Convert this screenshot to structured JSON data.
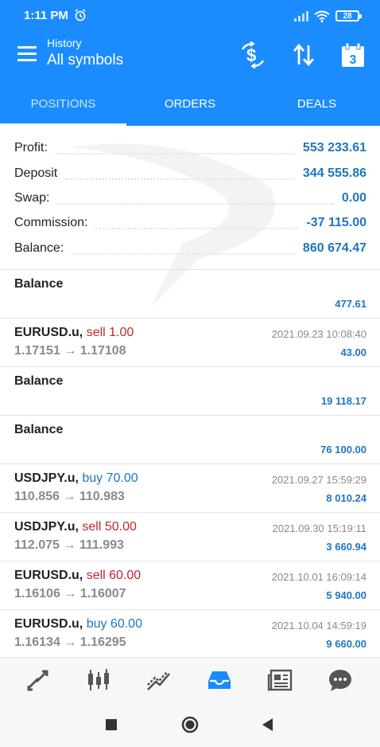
{
  "status_bar": {
    "time": "1:11 PM",
    "battery": "28",
    "icons": [
      "alarm-icon",
      "signal-icon",
      "wifi-icon",
      "battery-icon"
    ]
  },
  "header": {
    "subtitle": "History",
    "title": "All symbols",
    "actions": [
      "dollar-filter-icon",
      "sort-icon",
      "calendar-icon"
    ],
    "calendar_day": "3"
  },
  "tabs": [
    {
      "label": "POSITIONS",
      "active": true
    },
    {
      "label": "ORDERS",
      "active": false
    },
    {
      "label": "DEALS",
      "active": false
    }
  ],
  "summary": [
    {
      "label": "Profit:",
      "value": "553 233.61"
    },
    {
      "label": "Deposit",
      "value": "344 555.86"
    },
    {
      "label": "Swap:",
      "value": "0.00"
    },
    {
      "label": "Commission:",
      "value": "-37 115.00"
    },
    {
      "label": "Balance:",
      "value": "860 674.47"
    }
  ],
  "items": [
    {
      "symbol": "Balance",
      "type": "",
      "side": "",
      "prices": "",
      "time": "",
      "amount": "477.61"
    },
    {
      "symbol": "EURUSD.u,",
      "type": "sell 1.00",
      "side": "sell",
      "prices": "1.17151 → 1.17108",
      "time": "2021.09.23 10:08:40",
      "amount": "43.00"
    },
    {
      "symbol": "Balance",
      "type": "",
      "side": "",
      "prices": "",
      "time": "",
      "amount": "19 118.17"
    },
    {
      "symbol": "Balance",
      "type": "",
      "side": "",
      "prices": "",
      "time": "",
      "amount": "76 100.00"
    },
    {
      "symbol": "USDJPY.u,",
      "type": "buy 70.00",
      "side": "buy",
      "prices": "110.856 → 110.983",
      "time": "2021.09.27 15:59:29",
      "amount": "8 010.24"
    },
    {
      "symbol": "USDJPY.u,",
      "type": "sell 50.00",
      "side": "sell",
      "prices": "112.075 → 111.993",
      "time": "2021.09.30 15:19:11",
      "amount": "3 660.94"
    },
    {
      "symbol": "EURUSD.u,",
      "type": "sell 60.00",
      "side": "sell",
      "prices": "1.16106 → 1.16007",
      "time": "2021.10.01 16:09:14",
      "amount": "5 940.00"
    },
    {
      "symbol": "EURUSD.u,",
      "type": "buy 60.00",
      "side": "buy",
      "prices": "1.16134 → 1.16295",
      "time": "2021.10.04 14:59:19",
      "amount": "9 660.00"
    }
  ],
  "bottom_nav": [
    {
      "icon": "quotes-arrows-icon",
      "active": false
    },
    {
      "icon": "candlestick-chart-icon",
      "active": false
    },
    {
      "icon": "trade-chart-icon",
      "active": false
    },
    {
      "icon": "history-inbox-icon",
      "active": true
    },
    {
      "icon": "news-icon",
      "active": false
    },
    {
      "icon": "chat-icon",
      "active": false
    }
  ],
  "system_nav": [
    "recents-square-icon",
    "home-circle-icon",
    "back-triangle-icon"
  ],
  "colors": {
    "primary": "#1a8cff",
    "value_blue": "#1f75c2",
    "sell_red": "#c0262a",
    "muted": "#8a8a8a"
  }
}
